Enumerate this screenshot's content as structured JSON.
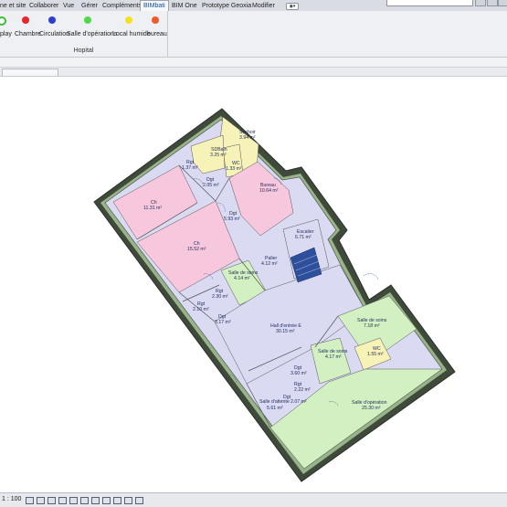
{
  "tabs": [
    {
      "label": "ne et site"
    },
    {
      "label": "Collaborer"
    },
    {
      "label": "Vue"
    },
    {
      "label": "Gérer"
    },
    {
      "label": "Compléments"
    },
    {
      "label": "BIMbati"
    },
    {
      "label": "BIM One"
    },
    {
      "label": "Prototype Geoxia"
    },
    {
      "label": "Modifier"
    }
  ],
  "ribbon": {
    "group_label": "Hopital",
    "buttons": [
      {
        "label": "play",
        "color": "#ffffff"
      },
      {
        "label": "Chambre",
        "color": "#e8262b"
      },
      {
        "label": "Circulation",
        "color": "#2a3fd0"
      },
      {
        "label": "Salle d'opérations",
        "color": "#52d64a"
      },
      {
        "label": "Local humide",
        "color": "#f3e21c"
      },
      {
        "label": "bureau",
        "color": "#f05a28"
      }
    ]
  },
  "rooms": [
    {
      "name": "Séchoir",
      "area": "3.94 m²",
      "color": "#f7f3b8"
    },
    {
      "name": "SDBain",
      "area": "3.25 m²",
      "color": "#f7f3b8"
    },
    {
      "name": "WC",
      "area": "1.33 m²",
      "color": "#f7f3b8"
    },
    {
      "name": "Rgt",
      "area": "1.37 m²",
      "color": "#d7d7f2"
    },
    {
      "name": "Dgt",
      "area": "2.05 m²",
      "color": "#d7d7f2"
    },
    {
      "name": "Bureau",
      "area": "10.64 m²",
      "color": "#f7c8dd"
    },
    {
      "name": "Ch",
      "area": "11.31 m²",
      "color": "#f7c8dd"
    },
    {
      "name": "Dgt",
      "area": "5.93 m²",
      "color": "#d7d7f2"
    },
    {
      "name": "Escalier",
      "area": "6.71 m²",
      "color": "#d7d7f2"
    },
    {
      "name": "Ch",
      "area": "15.52 m²",
      "color": "#f7c8dd"
    },
    {
      "name": "Palier",
      "area": "4.12 m²",
      "color": "#d7d7f2"
    },
    {
      "name": "Salle de soins",
      "area": "4.14 m²",
      "color": "#d2f0c2"
    },
    {
      "name": "Rgt",
      "area": "2.30 m²",
      "color": "#d7d7f2"
    },
    {
      "name": "Rgt",
      "area": "2.10 m²",
      "color": "#d7d7f2"
    },
    {
      "name": "Dgt",
      "area": "3.17 m²",
      "color": "#d7d7f2"
    },
    {
      "name": "Hall d'entrée E",
      "area": "30.15 m²",
      "color": "#d7d7f2"
    },
    {
      "name": "Salle de soins",
      "area": "7.18 m²",
      "color": "#d2f0c2"
    },
    {
      "name": "Salle de soins",
      "area": "4.17 m²",
      "color": "#d2f0c2"
    },
    {
      "name": "WC",
      "area": "1.55 m²",
      "color": "#f7f3b8"
    },
    {
      "name": "Dgt",
      "area": "3.60 m²",
      "color": "#d7d7f2"
    },
    {
      "name": "Rgt",
      "area": "2.22 m²",
      "color": "#d7d7f2"
    },
    {
      "name": "Salle d'attente",
      "area": "2.07 m²",
      "color": "#d7d7f2"
    },
    {
      "name": "Salle d'opération",
      "area": "25.30 m²",
      "color": "#d2f0c2"
    },
    {
      "name": "Dgt",
      "area": "5.61 m²",
      "color": "#d7d7f2"
    }
  ],
  "status": {
    "scale": "1 : 100"
  }
}
